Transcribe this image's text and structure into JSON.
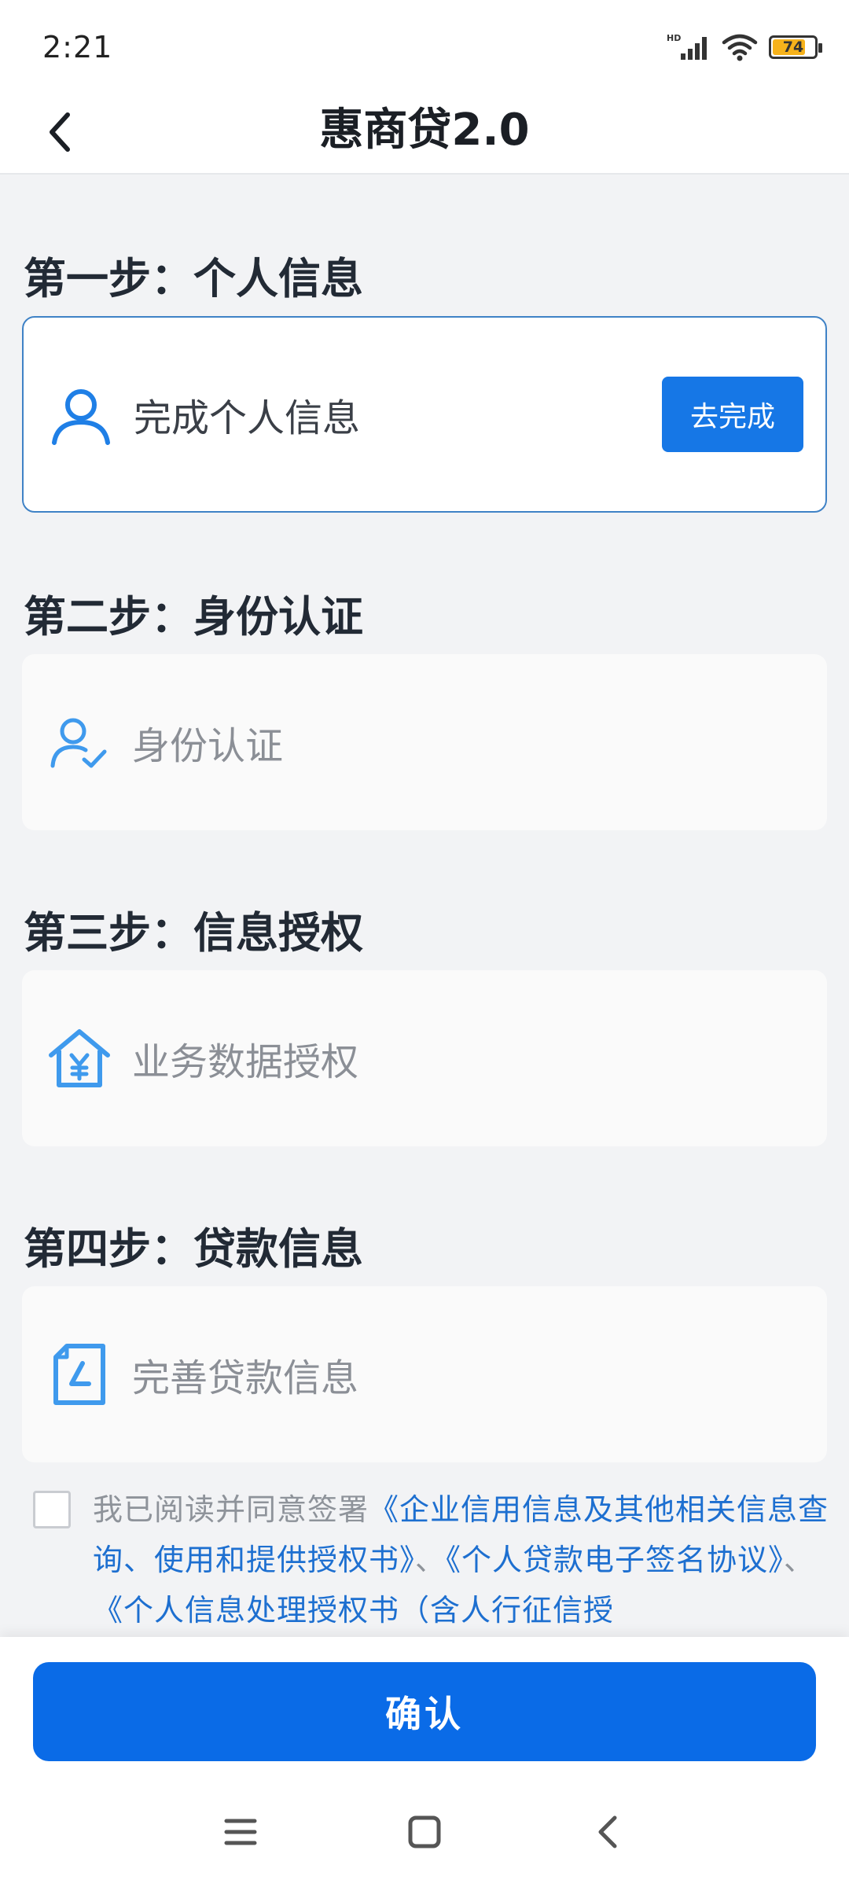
{
  "status_bar": {
    "time": "2:21",
    "battery_level": "74",
    "network_label": "HD"
  },
  "nav": {
    "title": "惠商贷2.0"
  },
  "steps": [
    {
      "title": "第一步：个人信息",
      "card_label": "完成个人信息",
      "action_label": "去完成"
    },
    {
      "title": "第二步：身份认证",
      "card_label": "身份认证"
    },
    {
      "title": "第三步：信息授权",
      "card_label": "业务数据授权"
    },
    {
      "title": "第四步：贷款信息",
      "card_label": "完善贷款信息"
    }
  ],
  "agreement": {
    "prefix": "我已阅读并同意签署",
    "link_1": "《企业信用信息及其他相关信息查询、使用和提供授权书》",
    "separator": "、",
    "link_2": "《个人贷款电子签名协议》",
    "link_3": "《个人信息处理授权书（含人行征信授"
  },
  "confirm_label": "确认",
  "colors": {
    "primary": "#0a6be7",
    "link": "#1d6fd0",
    "icon": "#3f9aed",
    "battery": "#f6b21b"
  }
}
